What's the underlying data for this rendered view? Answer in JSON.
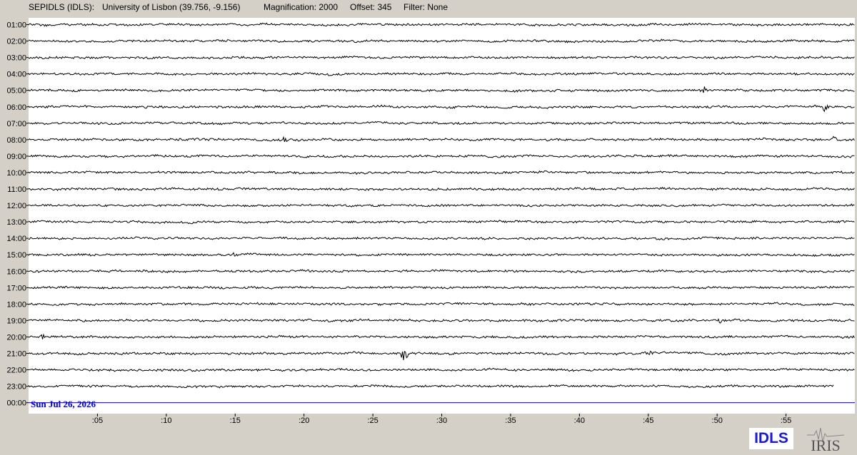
{
  "header": {
    "station": "SEPIDLS (IDLS):",
    "location": "University of Lisbon (39.756, -9.156)",
    "magnification": "Magnification: 2000",
    "offset": "Offset: 345",
    "filter": "Filter: None"
  },
  "date_label": "Sun Jul 26, 2026",
  "logos": {
    "idls": "IDLS",
    "iris": "IRIS"
  },
  "colors": {
    "background": "#d4d0c8",
    "plot_background": "#ffffff",
    "trace": "#000000",
    "marker": "#0000cc",
    "date_text": "#0000cc"
  },
  "chart_data": {
    "type": "line",
    "title": "",
    "xlabel": "",
    "ylabel": "",
    "x_ticks": [
      ":05",
      ":10",
      ":15",
      ":20",
      ":25",
      ":30",
      ":35",
      ":40",
      ":45",
      ":50",
      ":55"
    ],
    "x_tick_minutes": [
      5,
      10,
      15,
      20,
      25,
      30,
      35,
      40,
      45,
      50,
      55
    ],
    "xlim": [
      0,
      60
    ],
    "rows": [
      "01:00",
      "02:00",
      "03:00",
      "04:00",
      "05:00",
      "06:00",
      "07:00",
      "08:00",
      "09:00",
      "10:00",
      "11:00",
      "12:00",
      "13:00",
      "14:00",
      "15:00",
      "16:00",
      "17:00",
      "18:00",
      "19:00",
      "20:00",
      "21:00",
      "22:00",
      "23:00",
      "00:00"
    ],
    "last_trace_end_minute": 58.5,
    "current_time_row": "00:00",
    "events": [
      {
        "row": "21:00",
        "minute": 27.3,
        "amplitude": 3.0
      },
      {
        "row": "06:00",
        "minute": 57.8,
        "amplitude": 1.2
      },
      {
        "row": "05:00",
        "minute": 49.0,
        "amplitude": 0.9
      },
      {
        "row": "19:00",
        "minute": 50.2,
        "amplitude": 0.9
      },
      {
        "row": "20:00",
        "minute": 1.0,
        "amplitude": 0.8
      },
      {
        "row": "08:00",
        "minute": 18.5,
        "amplitude": 0.8
      },
      {
        "row": "08:00",
        "minute": 58.5,
        "amplitude": 0.8
      },
      {
        "row": "15:00",
        "minute": 15.0,
        "amplitude": 0.7
      },
      {
        "row": "21:00",
        "minute": 45.0,
        "amplitude": 0.6
      }
    ]
  }
}
